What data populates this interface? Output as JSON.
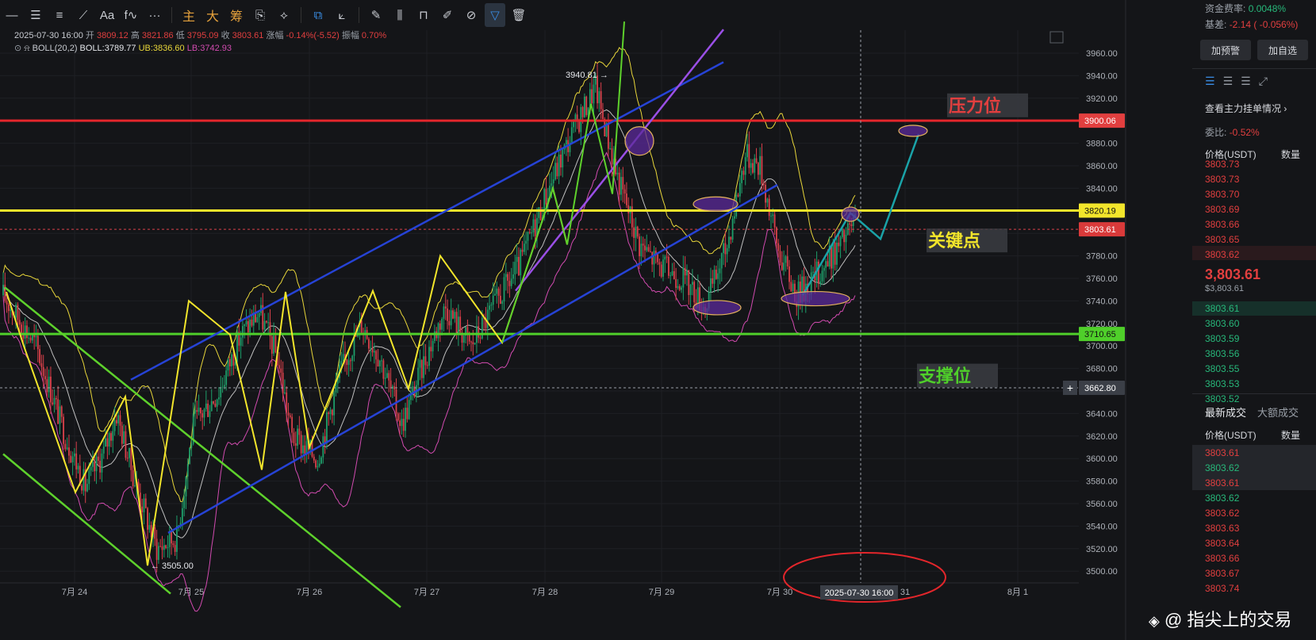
{
  "toolbar": {
    "items": [
      {
        "name": "horizontal-line-icon",
        "glyph": "—"
      },
      {
        "name": "horizontal-ray-icon",
        "glyph": "☰"
      },
      {
        "name": "parallel-lines-icon",
        "glyph": "≡"
      },
      {
        "name": "trend-line-icon",
        "glyph": "⟋"
      },
      {
        "name": "text-tool-icon",
        "glyph": "Aa"
      },
      {
        "name": "fib-tool-icon",
        "glyph": "f∿"
      },
      {
        "name": "more-tools-icon",
        "glyph": "···"
      },
      {
        "name": "main-indicator-button",
        "glyph": "主"
      },
      {
        "name": "size-button",
        "glyph": "大"
      },
      {
        "name": "chip-button",
        "glyph": "筹"
      },
      {
        "name": "screenshot-icon",
        "glyph": "⎘"
      },
      {
        "name": "measure-icon",
        "glyph": "⟡"
      },
      {
        "name": "copy-icon",
        "glyph": "⧉"
      },
      {
        "name": "ruler-icon",
        "glyph": "⟀"
      },
      {
        "name": "pencil-icon",
        "glyph": "✎"
      },
      {
        "name": "candles-icon",
        "glyph": "⫼"
      },
      {
        "name": "lock-icon",
        "glyph": "⊓"
      },
      {
        "name": "note-icon",
        "glyph": "✐"
      },
      {
        "name": "magnet-icon",
        "glyph": "⊘"
      },
      {
        "name": "filter-icon",
        "glyph": "▽"
      },
      {
        "name": "trash-icon",
        "glyph": "🗑"
      }
    ]
  },
  "header": {
    "datetime": "2025-07-30 16:00",
    "open_label": "开",
    "open": "3809.12",
    "high_label": "高",
    "high": "3821.86",
    "low_label": "低",
    "low": "3795.09",
    "close_label": "收",
    "close": "3803.61",
    "change_label": "涨幅",
    "change": "-0.14%(-5.52)",
    "amp_label": "振幅",
    "amp": "0.70%",
    "boll_label": "BOLL(20,2)",
    "boll": "BOLL:3789.77",
    "ub": "UB:3836.60",
    "lb": "LB:3742.93"
  },
  "chart_data": {
    "type": "candlestick",
    "y_ticks": [
      3500,
      3520,
      3540,
      3560,
      3580,
      3600,
      3620,
      3640,
      3660,
      3680,
      3700,
      3720,
      3740,
      3760,
      3780,
      3800,
      3820,
      3840,
      3860,
      3880,
      3900,
      3920,
      3940,
      3960
    ],
    "x_ticks": [
      "7月 24",
      "7月 25",
      "7月 26",
      "7月 27",
      "7月 28",
      "7月 29",
      "7月 30",
      "31",
      "8月 1"
    ],
    "crosshair_time": "2025-07-30 16:00",
    "price_labels": [
      {
        "value": 3900.06,
        "text": "3900.06",
        "color": "#e23f3f",
        "text_color": "#ffffff"
      },
      {
        "value": 3820.19,
        "text": "3820.19",
        "color": "#f2e52b",
        "text_color": "#111111"
      },
      {
        "value": 3803.61,
        "text": "3803.61",
        "color": "#d93a3a",
        "text_color": "#ffffff"
      },
      {
        "value": 3710.65,
        "text": "3710.65",
        "color": "#4fcf2a",
        "text_color": "#111111"
      },
      {
        "value": 3662.8,
        "text": "3662.80",
        "color": "#3b3f47",
        "text_color": "#ffffff"
      }
    ],
    "annotations": [
      {
        "text": "3940.81 →",
        "value": 3940.81
      },
      {
        "text": "← 3505.00",
        "value": 3505.0
      }
    ],
    "zone_labels": [
      {
        "text": "压力位",
        "color": "#e23f3f"
      },
      {
        "text": "关键点",
        "color": "#f2e52b"
      },
      {
        "text": "支撑位",
        "color": "#4fcf2a"
      }
    ],
    "lines": {
      "resistance": 3900.06,
      "key": 3820.19,
      "support": 3710.65,
      "last": 3803.61,
      "cursor": 3662.8
    }
  },
  "sidebar": {
    "funding_label": "资金费率:",
    "funding_value": "0.0048%",
    "basis_label": "基差:",
    "basis_value": "-2.14 ( -0.056%)",
    "alert_button": "加预警",
    "watch_button": "加自选",
    "depth_link": "查看主力挂单情况",
    "ratio_label": "委比:",
    "ratio_value": "-0.52%",
    "col_price": "价格(USDT)",
    "col_qty": "数量",
    "asks": [
      "3803.73",
      "3803.73",
      "3803.70",
      "3803.69",
      "3803.66",
      "3803.65",
      "3803.62"
    ],
    "last_price": "3,803.61",
    "last_price_usd": "$3,803.61",
    "bids": [
      "3803.61",
      "3803.60",
      "3803.59",
      "3803.56",
      "3803.55",
      "3803.53",
      "3803.52"
    ],
    "tab_latest": "最新成交",
    "tab_big": "大额成交",
    "trades_col_price": "价格(USDT)",
    "trades_col_qty": "数量",
    "trades": [
      {
        "price": "3803.61",
        "side": "sell"
      },
      {
        "price": "3803.62",
        "side": "buy"
      },
      {
        "price": "3803.61",
        "side": "sell"
      },
      {
        "price": "3803.62",
        "side": "buy"
      },
      {
        "price": "3803.62",
        "side": "sell"
      },
      {
        "price": "3803.63",
        "side": "sell"
      },
      {
        "price": "3803.64",
        "side": "sell"
      },
      {
        "price": "3803.66",
        "side": "sell"
      },
      {
        "price": "3803.67",
        "side": "sell"
      },
      {
        "price": "3803.74",
        "side": "sell"
      }
    ]
  },
  "watermark": "@ 指尖上的交易"
}
